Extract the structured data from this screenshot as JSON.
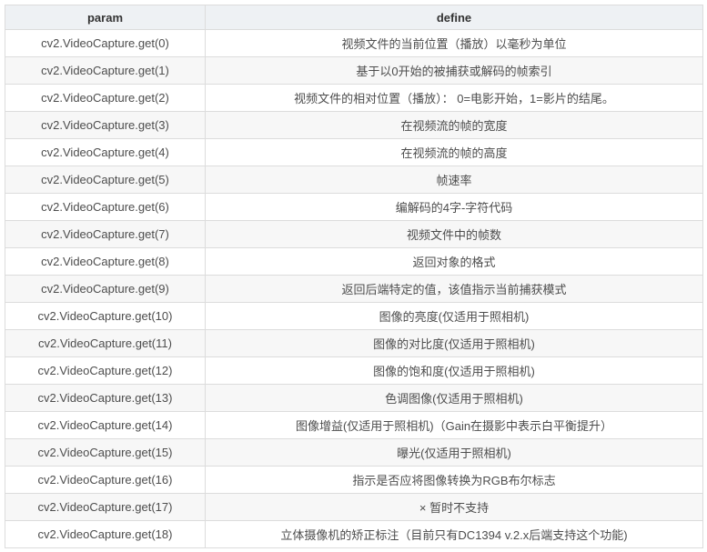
{
  "table": {
    "header": {
      "param": "param",
      "define": "define"
    },
    "rows": [
      {
        "param": "cv2.VideoCapture.get(0)",
        "define": "视频文件的当前位置（播放）以毫秒为单位"
      },
      {
        "param": "cv2.VideoCapture.get(1)",
        "define": "基于以0开始的被捕获或解码的帧索引"
      },
      {
        "param": "cv2.VideoCapture.get(2)",
        "define": "视频文件的相对位置（播放）： 0=电影开始，1=影片的结尾。"
      },
      {
        "param": "cv2.VideoCapture.get(3)",
        "define": "在视频流的帧的宽度"
      },
      {
        "param": "cv2.VideoCapture.get(4)",
        "define": "在视频流的帧的高度"
      },
      {
        "param": "cv2.VideoCapture.get(5)",
        "define": "帧速率"
      },
      {
        "param": "cv2.VideoCapture.get(6)",
        "define": "编解码的4字-字符代码"
      },
      {
        "param": "cv2.VideoCapture.get(7)",
        "define": "视频文件中的帧数"
      },
      {
        "param": "cv2.VideoCapture.get(8)",
        "define": "返回对象的格式"
      },
      {
        "param": "cv2.VideoCapture.get(9)",
        "define": "返回后端特定的值，该值指示当前捕获模式"
      },
      {
        "param": "cv2.VideoCapture.get(10)",
        "define": "图像的亮度(仅适用于照相机)"
      },
      {
        "param": "cv2.VideoCapture.get(11)",
        "define": "图像的对比度(仅适用于照相机)"
      },
      {
        "param": "cv2.VideoCapture.get(12)",
        "define": "图像的饱和度(仅适用于照相机)"
      },
      {
        "param": "cv2.VideoCapture.get(13)",
        "define": "色调图像(仅适用于照相机)"
      },
      {
        "param": "cv2.VideoCapture.get(14)",
        "define": "图像增益(仅适用于照相机)（Gain在摄影中表示白平衡提升）"
      },
      {
        "param": "cv2.VideoCapture.get(15)",
        "define": "曝光(仅适用于照相机)"
      },
      {
        "param": "cv2.VideoCapture.get(16)",
        "define": "指示是否应将图像转换为RGB布尔标志"
      },
      {
        "param": "cv2.VideoCapture.get(17)",
        "define": "× 暂时不支持"
      },
      {
        "param": "cv2.VideoCapture.get(18)",
        "define": "立体摄像机的矫正标注（目前只有DC1394 v.2.x后端支持这个功能)"
      }
    ],
    "colors": {
      "header_bg": "#eef1f4",
      "alt_row_bg": "#f7f7f7",
      "row_bg": "#ffffff",
      "border": "#dcdcdc",
      "header_text": "#333333",
      "cell_text": "#4d4d4d"
    }
  }
}
